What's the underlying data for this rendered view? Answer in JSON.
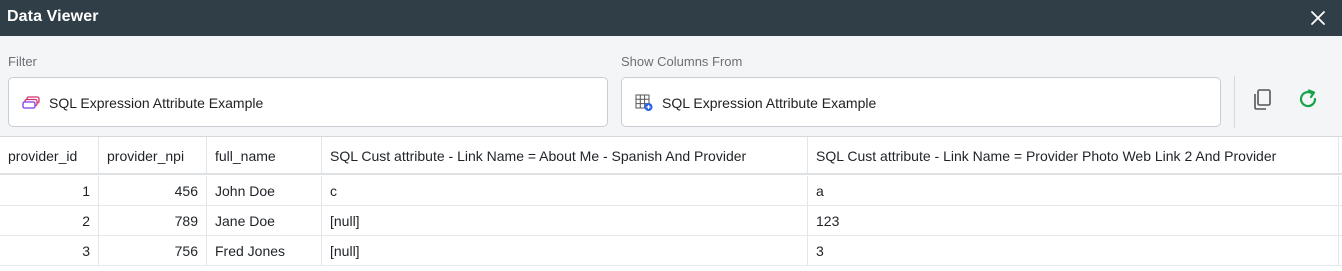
{
  "window": {
    "title": "Data Viewer",
    "close_icon": "close-icon"
  },
  "filter": {
    "label": "Filter",
    "value": "SQL Expression Attribute Example",
    "icon": "attribute-icon"
  },
  "show_columns": {
    "label": "Show Columns From",
    "value": "SQL Expression Attribute Example",
    "icon": "table-grid-icon"
  },
  "toolbar": {
    "copy_icon": "copy-icon",
    "refresh_icon": "refresh-icon",
    "refresh_color": "#16a34a",
    "accent": "#d6336c"
  },
  "table": {
    "columns": [
      "provider_id",
      "provider_npi",
      "full_name",
      "SQL Cust attribute - Link Name = About Me - Spanish  And Provider",
      "SQL Cust attribute - Link Name = Provider Photo Web Link  2  And Provider"
    ],
    "rows": [
      {
        "provider_id": "1",
        "provider_npi": "456",
        "full_name": "John Doe",
        "about_me": "c",
        "photo_link": "a"
      },
      {
        "provider_id": "2",
        "provider_npi": "789",
        "full_name": "Jane Doe",
        "about_me": "[null]",
        "photo_link": "123"
      },
      {
        "provider_id": "3",
        "provider_npi": "756",
        "full_name": "Fred Jones",
        "about_me": "[null]",
        "photo_link": "3"
      }
    ]
  }
}
